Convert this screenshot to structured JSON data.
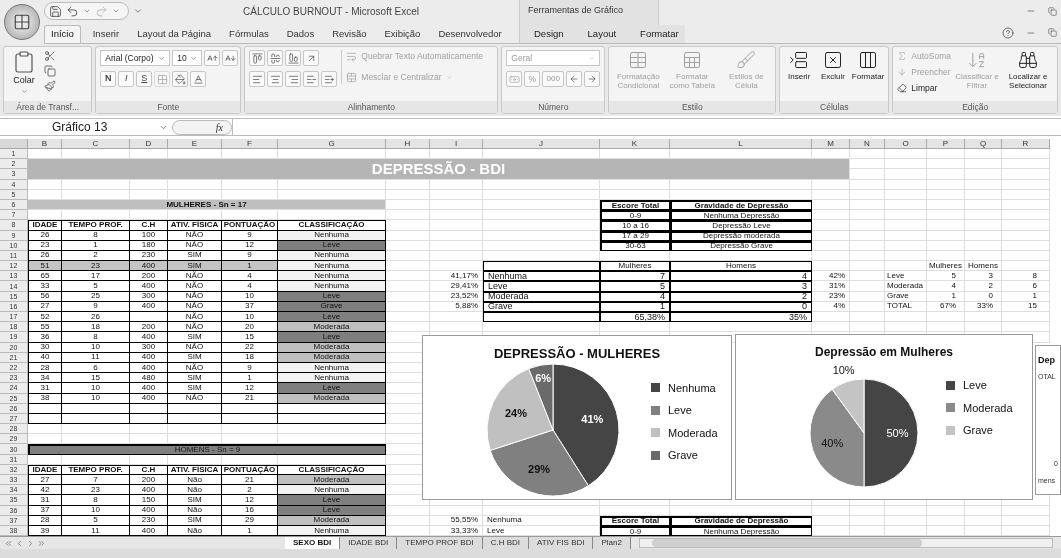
{
  "title_bar": {
    "title": "CÁLCULO BURNOUT - Microsoft Excel",
    "context_label": "Ferramentas de Gráfico"
  },
  "ribbon_tabs": [
    {
      "label": "Início",
      "selected": true,
      "context": false
    },
    {
      "label": "Inserir",
      "selected": false,
      "context": false
    },
    {
      "label": "Layout da Página",
      "selected": false,
      "context": false
    },
    {
      "label": "Fórmulas",
      "selected": false,
      "context": false
    },
    {
      "label": "Dados",
      "selected": false,
      "context": false
    },
    {
      "label": "Revisão",
      "selected": false,
      "context": false
    },
    {
      "label": "Exibição",
      "selected": false,
      "context": false
    },
    {
      "label": "Desenvolvedor",
      "selected": false,
      "context": false
    },
    {
      "label": "Design",
      "selected": false,
      "context": true
    },
    {
      "label": "Layout",
      "selected": false,
      "context": true
    },
    {
      "label": "Formatar",
      "selected": false,
      "context": true
    }
  ],
  "ribbon": {
    "clipboard": {
      "label": "Área de Transf...",
      "paste": "Colar"
    },
    "font": {
      "label": "Fonte",
      "family": "Arial (Corpo)",
      "size": "10",
      "bold": "N",
      "italic": "I",
      "underline": "S"
    },
    "alignment": {
      "label": "Alinhamento",
      "wrap": {
        "label": "Quebrar Texto Automaticamente",
        "disabled": true
      },
      "merge": {
        "label": "Mesclar e Centralizar",
        "disabled": true
      }
    },
    "number": {
      "label": "Número",
      "format": "Geral",
      "percent": "%",
      "thousands": "000"
    },
    "styles": {
      "label": "Estilo",
      "buttons": [
        {
          "label": "Formatação Condicional",
          "disabled": true
        },
        {
          "label": "Formatar como Tabela",
          "disabled": true
        },
        {
          "label": "Estilos de Célula",
          "disabled": true
        }
      ]
    },
    "cells": {
      "label": "Células",
      "buttons": [
        {
          "label": "Inserir",
          "disabled": false
        },
        {
          "label": "Excluir",
          "disabled": false
        },
        {
          "label": "Formatar",
          "disabled": false
        }
      ]
    },
    "editing": {
      "label": "Edição",
      "autosum": {
        "label": "AutoSoma",
        "disabled": true
      },
      "fill": {
        "label": "Preencher",
        "disabled": true
      },
      "clear": {
        "label": "Limpar",
        "disabled": false
      },
      "sort": {
        "label": "Classificar e Filtrar",
        "disabled": true
      },
      "find": {
        "label": "Localizar e Selecionar",
        "disabled": false
      }
    }
  },
  "formula_bar": {
    "name_box": "Gráfico 13",
    "function_label": "fx"
  },
  "columns": [
    "B",
    "C",
    "D",
    "E",
    "F",
    "G",
    "H",
    "I",
    "J",
    "K",
    "L",
    "M",
    "N",
    "O",
    "P",
    "Q",
    "R"
  ],
  "row_numbers": [
    "1",
    "2",
    "3",
    "4",
    "5",
    "6",
    "7",
    "8",
    "9",
    "10",
    "11",
    "12",
    "13",
    "14",
    "15",
    "16",
    "17",
    "18",
    "19",
    "20",
    "21",
    "22",
    "23",
    "24",
    "25",
    "26",
    "27",
    "28",
    "29",
    "30",
    "31",
    "32",
    "33",
    "34",
    "35",
    "36",
    "37",
    "38"
  ],
  "sheet": {
    "title": "DEPRESSÃO - BDI",
    "women": {
      "heading": "MULHERES - Sn = 17",
      "columns": [
        "IDADE",
        "TEMPO PROF.",
        "C.H",
        "ATIV. FÍSICA",
        "PONTUAÇÃO",
        "CLASSIFICAÇÃO"
      ],
      "rows": [
        {
          "cells": [
            "26",
            "8",
            "100",
            "NÃO",
            "9"
          ],
          "class": "Nenhuma",
          "color": "#f2f2f2",
          "highlighted": false
        },
        {
          "cells": [
            "23",
            "1",
            "180",
            "NÃO",
            "12"
          ],
          "class": "Leve",
          "color": "#7f7f7f",
          "highlighted": false
        },
        {
          "cells": [
            "26",
            "2",
            "230",
            "SIM",
            "9"
          ],
          "class": "Nenhuma",
          "color": "#f2f2f2",
          "highlighted": false
        },
        {
          "cells": [
            "51",
            "23",
            "400",
            "SIM",
            "1"
          ],
          "class": "Nenhuma",
          "color": "#f2f2f2",
          "highlighted": true
        },
        {
          "cells": [
            "65",
            "17",
            "200",
            "NÃO",
            "4"
          ],
          "class": "Nenhuma",
          "color": "#f2f2f2",
          "highlighted": false
        },
        {
          "cells": [
            "33",
            "5",
            "400",
            "NÃO",
            "4"
          ],
          "class": "Nenhuma",
          "color": "#f2f2f2",
          "highlighted": false
        },
        {
          "cells": [
            "56",
            "25",
            "300",
            "NÃO",
            "10"
          ],
          "class": "Leve",
          "color": "#7f7f7f",
          "highlighted": false
        },
        {
          "cells": [
            "27",
            "9",
            "400",
            "NÃO",
            "37"
          ],
          "class": "Grave",
          "color": "#7f7f7f",
          "highlighted": false
        },
        {
          "cells": [
            "52",
            "26",
            null,
            "NÃO",
            "10"
          ],
          "class": "Leve",
          "color": "#7f7f7f",
          "highlighted": false
        },
        {
          "cells": [
            "55",
            "18",
            "200",
            "NÃO",
            "20"
          ],
          "class": "Moderada",
          "color": "#bfbfbf",
          "highlighted": false
        },
        {
          "cells": [
            "36",
            "8",
            "400",
            "SIM",
            "15"
          ],
          "class": "Leve",
          "color": "#7f7f7f",
          "highlighted": false
        },
        {
          "cells": [
            "30",
            "10",
            "300",
            "NÃO",
            "22"
          ],
          "class": "Moderada",
          "color": "#bfbfbf",
          "highlighted": false
        },
        {
          "cells": [
            "40",
            "11",
            "400",
            "SIM",
            "18"
          ],
          "class": "Moderada",
          "color": "#bfbfbf",
          "highlighted": false
        },
        {
          "cells": [
            "28",
            "6",
            "400",
            "NÃO",
            "9"
          ],
          "class": "Nenhuma",
          "color": "#f2f2f2",
          "highlighted": false
        },
        {
          "cells": [
            "34",
            "15",
            "480",
            "SIM",
            "1"
          ],
          "class": "Nenhuma",
          "color": "#f2f2f2",
          "highlighted": false
        },
        {
          "cells": [
            "31",
            "10",
            "400",
            "SIM",
            "12"
          ],
          "class": "Leve",
          "color": "#7f7f7f",
          "highlighted": false
        },
        {
          "cells": [
            "38",
            "10",
            "400",
            "NÃO",
            "21"
          ],
          "class": "Moderada",
          "color": "#bfbfbf",
          "highlighted": false
        }
      ]
    },
    "men": {
      "heading": "HOMENS - Sn = 9",
      "columns": [
        "IDADE",
        "TEMPO PROF.",
        "C.H",
        "ATIV. FÍSICA",
        "PONTUAÇÃO",
        "CLASSIFICAÇÃO"
      ],
      "rows": [
        {
          "cells": [
            "27",
            "7",
            "200",
            "Não",
            "21"
          ],
          "class": "Moderada",
          "color": "#bfbfbf"
        },
        {
          "cells": [
            "42",
            "23",
            "400",
            "Não",
            "2"
          ],
          "class": "Nenhuma",
          "color": "#f2f2f2"
        },
        {
          "cells": [
            "31",
            "8",
            "150",
            "SIM",
            "12"
          ],
          "class": "Leve",
          "color": "#7f7f7f"
        },
        {
          "cells": [
            "37",
            "10",
            "400",
            "Não",
            "16"
          ],
          "class": "Leve",
          "color": "#7f7f7f"
        },
        {
          "cells": [
            "28",
            "5",
            "230",
            "SIM",
            "29"
          ],
          "class": "Moderada",
          "color": "#bfbfbf"
        },
        {
          "cells": [
            "39",
            "11",
            "400",
            "Não",
            "1"
          ],
          "class": "Nenhuma",
          "color": "#f2f2f2"
        }
      ]
    },
    "score_table": {
      "columns": [
        "Escore Total",
        "Gravidade de Depressão"
      ],
      "rows": [
        [
          "0-9",
          "Nenhuma Depressão"
        ],
        [
          "10 a 16",
          "Depressão Leve"
        ],
        [
          "17 a 29",
          "Depressão moderada"
        ],
        [
          "30-63",
          "Depressão Grave"
        ]
      ]
    },
    "distribution": {
      "columns": [
        "Mulheres",
        "Homens"
      ],
      "rows": [
        {
          "share": "41,17%",
          "label": "Nenhuma",
          "women": "7",
          "men": "4",
          "percent": "42%"
        },
        {
          "share": "29,41%",
          "label": "Leve",
          "women": "5",
          "men": "3",
          "percent": "31%"
        },
        {
          "share": "23,52%",
          "label": "Moderada",
          "women": "4",
          "men": "2",
          "percent": "23%"
        },
        {
          "share": "5,88%",
          "label": "Grave",
          "women": "1",
          "men": "0",
          "percent": "4%"
        }
      ],
      "totals": [
        "65,38%",
        "35%"
      ]
    },
    "summary": {
      "columns": [
        "Mulheres",
        "Homens"
      ],
      "rows": [
        {
          "label": "Leve",
          "women": "5",
          "men": "3",
          "total": "8"
        },
        {
          "label": "Moderada",
          "women": "4",
          "men": "2",
          "total": "6"
        },
        {
          "label": "Grave",
          "women": "1",
          "men": "0",
          "total": "1"
        },
        {
          "label": "TOTAL",
          "women": "67%",
          "men": "33%",
          "total": "15"
        }
      ]
    },
    "lower": {
      "rows": [
        {
          "share": "55,55%",
          "label": "Nenhuma"
        },
        {
          "share": "33,33%",
          "label": "Leve"
        }
      ],
      "score_columns": [
        "Escore Total",
        "Gravidade de Depressão"
      ],
      "score_row": [
        "0-9",
        "Nenhuma Depressão"
      ]
    }
  },
  "charts": [
    {
      "chart_data": {
        "type": "pie",
        "title": "DEPRESSÃO - MULHERES",
        "categories": [
          "Nenhuma",
          "Leve",
          "Moderada",
          "Grave"
        ],
        "values": [
          41,
          29,
          24,
          6
        ],
        "value_labels": [
          "41%",
          "29%",
          "24%",
          "6%"
        ],
        "legend": "right"
      }
    },
    {
      "chart_data": {
        "type": "pie",
        "title": "Depressão em Mulheres",
        "categories": [
          "Leve",
          "Moderada",
          "Grave"
        ],
        "values": [
          50,
          40,
          10
        ],
        "value_labels": [
          "50%",
          "40%",
          "10%"
        ],
        "legend": "right"
      }
    }
  ],
  "partial_chart": {
    "title": "Dep",
    "texts": [
      "OTAL",
      "0",
      "mens"
    ]
  },
  "sheet_tabs": [
    {
      "label": "SEXO BDI",
      "selected": true
    },
    {
      "label": "IDADE BDI",
      "selected": false
    },
    {
      "label": "TEMPO PROF BDI",
      "selected": false
    },
    {
      "label": "C.H BDI",
      "selected": false
    },
    {
      "label": "ATIV FIS BDI",
      "selected": false
    },
    {
      "label": "Plan2",
      "selected": false
    }
  ]
}
